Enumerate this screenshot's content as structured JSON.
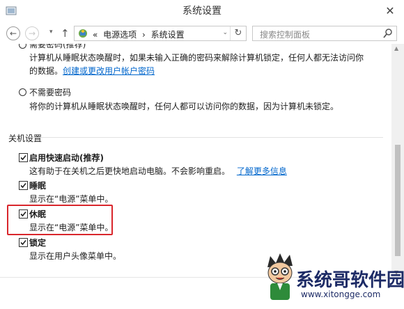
{
  "window": {
    "title": "系统设置",
    "close_glyph": "✕"
  },
  "nav": {
    "back_glyph": "←",
    "forward_glyph": "→",
    "dropdown_glyph": "▾",
    "up_glyph": "↑",
    "breadcrumb": [
      "«",
      "电源选项",
      "›",
      "系统设置"
    ],
    "chevron_glyph": "⌄",
    "refresh_glyph": "↻",
    "search_placeholder": "搜索控制面板"
  },
  "password_section": {
    "option1_title_partial": "需要密码(推荐)",
    "option1_desc_line1": "计算机从睡眠状态唤醒时，如果未输入正确的密码来解除计算机锁定，任何人都无法访问你",
    "option1_desc_line2": "的数据。",
    "option1_link": "创建或更改用户帐户密码",
    "option2_title": "不需要密码",
    "option2_desc": "将你的计算机从睡眠状态唤醒时，任何人都可以访问你的数据，因为计算机未锁定。"
  },
  "shutdown_section": {
    "header": "关机设置",
    "items": [
      {
        "label": "启用快速启动(推荐)",
        "desc": "这有助于在关机之后更快地启动电脑。不会影响重启。",
        "link": "了解更多信息",
        "checked": true
      },
      {
        "label": "睡眠",
        "desc": "显示在“电源”菜单中。",
        "checked": true
      },
      {
        "label": "休眠",
        "desc": "显示在“电源”菜单中。",
        "checked": true,
        "highlighted": true
      },
      {
        "label": "锁定",
        "desc": "显示在用户头像菜单中。",
        "checked": true
      }
    ]
  },
  "watermark": {
    "title": "系统哥软件园",
    "url": "www.xitongge.com"
  },
  "colors": {
    "link": "#0066cc",
    "highlight": "#d9262c",
    "watermark": "#1d2b66"
  }
}
